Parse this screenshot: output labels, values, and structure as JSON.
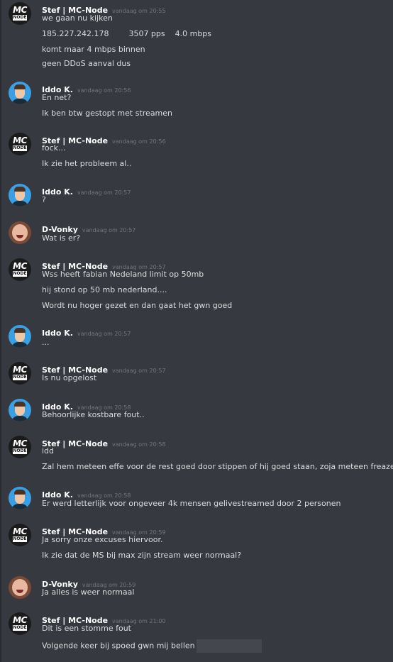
{
  "chat": {
    "messages": [
      {
        "author": "Stef | MC-Node",
        "avatar": "mc-node-logo",
        "avatar_text": [
          "MC",
          "NODE"
        ],
        "time": "vandaag om 20:55",
        "lines": [
          "we gaan nu kijken",
          "185.227.242.178        3507 pps    4.0 mbps",
          "komt maar 4 mbps binnen",
          "geen DDoS aanval dus"
        ]
      },
      {
        "author": "Iddo K.",
        "avatar": "iddo-photo",
        "time": "vandaag om 20:56",
        "lines": [
          "En net?",
          "Ik ben btw gestopt met streamen"
        ]
      },
      {
        "author": "Stef | MC-Node",
        "avatar": "mc-node-logo",
        "avatar_text": [
          "MC",
          "NODE"
        ],
        "time": "vandaag om 20:56",
        "lines": [
          "fock...",
          "Ik zie het probleem al.."
        ]
      },
      {
        "author": "Iddo K.",
        "avatar": "iddo-photo",
        "time": "vandaag om 20:57",
        "lines": [
          "?"
        ]
      },
      {
        "author": "D-Vonky",
        "avatar": "vonky-photo",
        "time": "vandaag om 20:57",
        "lines": [
          "Wat is er?"
        ]
      },
      {
        "author": "Stef | MC-Node",
        "avatar": "mc-node-logo",
        "avatar_text": [
          "MC",
          "NODE"
        ],
        "time": "vandaag om 20:57",
        "lines": [
          "Wss heeft fabian Nedeland limit op 50mb",
          "hij stond op 50 mb nederland....",
          "Wordt nu hoger gezet en dan gaat het gwn goed"
        ]
      },
      {
        "author": "Iddo K.",
        "avatar": "iddo-photo",
        "time": "vandaag om 20:57",
        "lines": [
          "..."
        ]
      },
      {
        "author": "Stef | MC-Node",
        "avatar": "mc-node-logo",
        "avatar_text": [
          "MC",
          "NODE"
        ],
        "time": "vandaag om 20:57",
        "lines": [
          "Is nu opgelost"
        ]
      },
      {
        "author": "Iddo K.",
        "avatar": "iddo-photo",
        "time": "vandaag om 20:58",
        "lines": [
          "Behoorlijke kostbare fout.."
        ]
      },
      {
        "author": "Stef | MC-Node",
        "avatar": "mc-node-logo",
        "avatar_text": [
          "MC",
          "NODE"
        ],
        "time": "vandaag om 20:58",
        "lines": [
          "idd",
          "Zal hem meteen effe voor de rest goed door stippen of hij goed staan, zoja meteen freazen."
        ]
      },
      {
        "author": "Iddo K.",
        "avatar": "iddo-photo",
        "time": "vandaag om 20:58",
        "lines": [
          "Er werd letterlijk voor ongeveer 4k mensen gelivestreamed door 2 personen"
        ]
      },
      {
        "author": "Stef | MC-Node",
        "avatar": "mc-node-logo",
        "avatar_text": [
          "MC",
          "NODE"
        ],
        "time": "vandaag om 20:59",
        "lines": [
          "Ja sorry onze excuses hiervoor.",
          "Ik zie dat de MS bij max zijn stream weer normaal?"
        ]
      },
      {
        "author": "D-Vonky",
        "avatar": "vonky-photo",
        "time": "vandaag om 20:59",
        "lines": [
          "Ja alles is weer normaal"
        ]
      },
      {
        "author": "Stef | MC-Node",
        "avatar": "mc-node-logo",
        "avatar_text": [
          "MC",
          "NODE"
        ],
        "time": "vandaag om 21:00",
        "lines": [
          "Dit is een stomme fout",
          "Volgende keer bij spoed gwn mij bellen"
        ],
        "redacted_after_last_line": true
      }
    ]
  }
}
